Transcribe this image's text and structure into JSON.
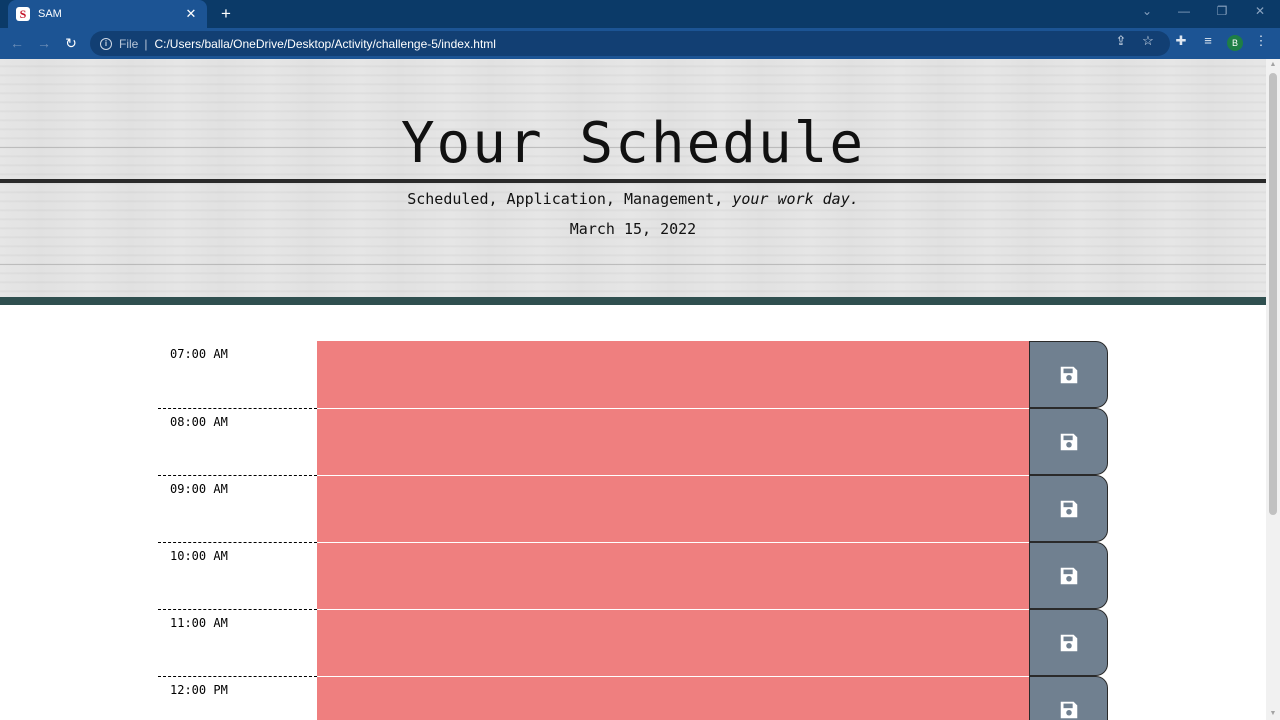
{
  "browser": {
    "tab_title": "SAM",
    "tab_favicon_letter": "S",
    "url_scheme_label": "File",
    "url": "C:/Users/balla/OneDrive/Desktop/Activity/challenge-5/index.html",
    "profile_initial": "B"
  },
  "header": {
    "title": "Your Schedule",
    "subtitle": "Scheduled, Application, Management,",
    "subtitle_em": "your work day.",
    "current_day": "March 15, 2022"
  },
  "timeblocks": [
    {
      "hour": "07:00 AM",
      "text": ""
    },
    {
      "hour": "08:00 AM",
      "text": ""
    },
    {
      "hour": "09:00 AM",
      "text": ""
    },
    {
      "hour": "10:00 AM",
      "text": ""
    },
    {
      "hour": "11:00 AM",
      "text": ""
    },
    {
      "hour": "12:00 PM",
      "text": ""
    }
  ],
  "colors": {
    "past_block": "#ef7f7f",
    "save_button": "#708090",
    "header_border": "#2f4f4f",
    "browser_tabbar": "#0b3a68",
    "browser_toolbar": "#1c5494"
  },
  "icons": {
    "save": "floppy-disk-icon"
  }
}
